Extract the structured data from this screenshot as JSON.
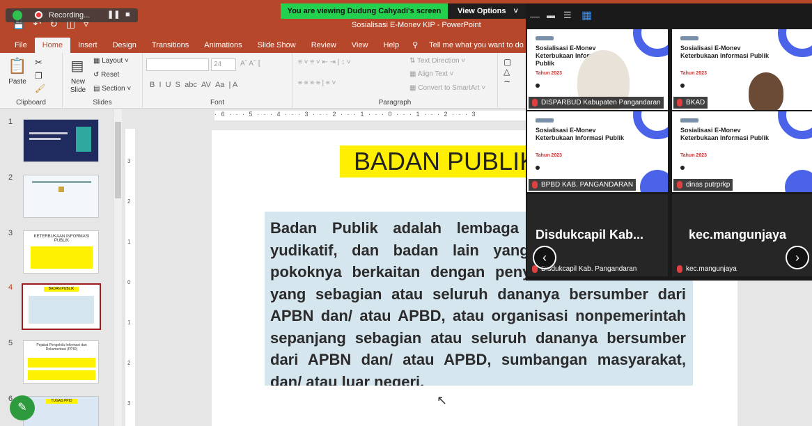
{
  "zoom": {
    "recording_label": "Recording...",
    "share_banner": "You are viewing Dudung Cahyadi's screen",
    "view_options": "View Options"
  },
  "ppt": {
    "title": "Sosialisasi E-Monev KIP - PowerPoint",
    "tabs": [
      "File",
      "Home",
      "Insert",
      "Design",
      "Transitions",
      "Animations",
      "Slide Show",
      "Review",
      "View",
      "Help"
    ],
    "tell_me": "Tell me what you want to do",
    "ribbon": {
      "paste": "Paste",
      "clipboard": "Clipboard",
      "new_slide": "New Slide",
      "layout": "Layout",
      "reset": "Reset",
      "section": "Section",
      "slides": "Slides",
      "font_size": "24",
      "font": "Font",
      "text_direction": "Text Direction",
      "align_text": "Align Text",
      "convert_smartart": "Convert to SmartArt",
      "paragraph": "Paragraph"
    },
    "slide_numbers": [
      "1",
      "2",
      "3",
      "4",
      "5",
      "6"
    ],
    "thumb3_title": "KETERBUKAAN INFORMASI PUBLIK",
    "thumb4_title": "BADAN PUBLIK",
    "thumb5_title": "Pejabat Pengelola Informasi dan Dokumentasi (PPID)",
    "thumb6_title": "TUGAS PPID",
    "hruler": "· 6 · · · 5 · · · 4 · · · 3 · · · 2 · · · 1 · · · 0 · · · 1 · · · 2 · · · 3",
    "vruler": [
      "3",
      "2",
      "1",
      "0",
      "1",
      "2",
      "3"
    ],
    "slide": {
      "title": "BADAN PUBLIK",
      "body": "Badan Publik adalah lembaga eksekutif, legislatif, yudikatif, dan badan lain yang fungsi dan tugas pokoknya berkaitan dengan penyelenggaraan negara, yang sebagian atau seluruh dananya bersumber dari APBN dan/ atau APBD, atau organisasi nonpemerintah sepanjang sebagian atau seluruh dananya bersumber dari APBN dan/ atau APBD, sumbangan masyarakat, dan/ atau luar negeri."
    }
  },
  "gallery": {
    "tile_title": "Sosialisasi E-Monev Keterbukaan Informasi Publik",
    "tile_year": "Tahun 2023",
    "participants": [
      "DISPARBUD Kabupaten Pangandaran",
      "BKAD",
      "BPBD KAB. PANGANDARAN",
      "dinas putrprkp"
    ],
    "dark_tiles": [
      {
        "big": "Disdukcapil Kab...",
        "small": "Disdukcapil Kab. Pangandaran"
      },
      {
        "big": "kec.mangunjaya",
        "small": "kec.mangunjaya"
      }
    ],
    "prev": "‹",
    "next": "›"
  },
  "colors": {
    "ppt_accent": "#b7472a",
    "share_green": "#24d14f",
    "slide_title_bg": "#ffef00",
    "slide_body_bg": "#d6e6ef"
  }
}
